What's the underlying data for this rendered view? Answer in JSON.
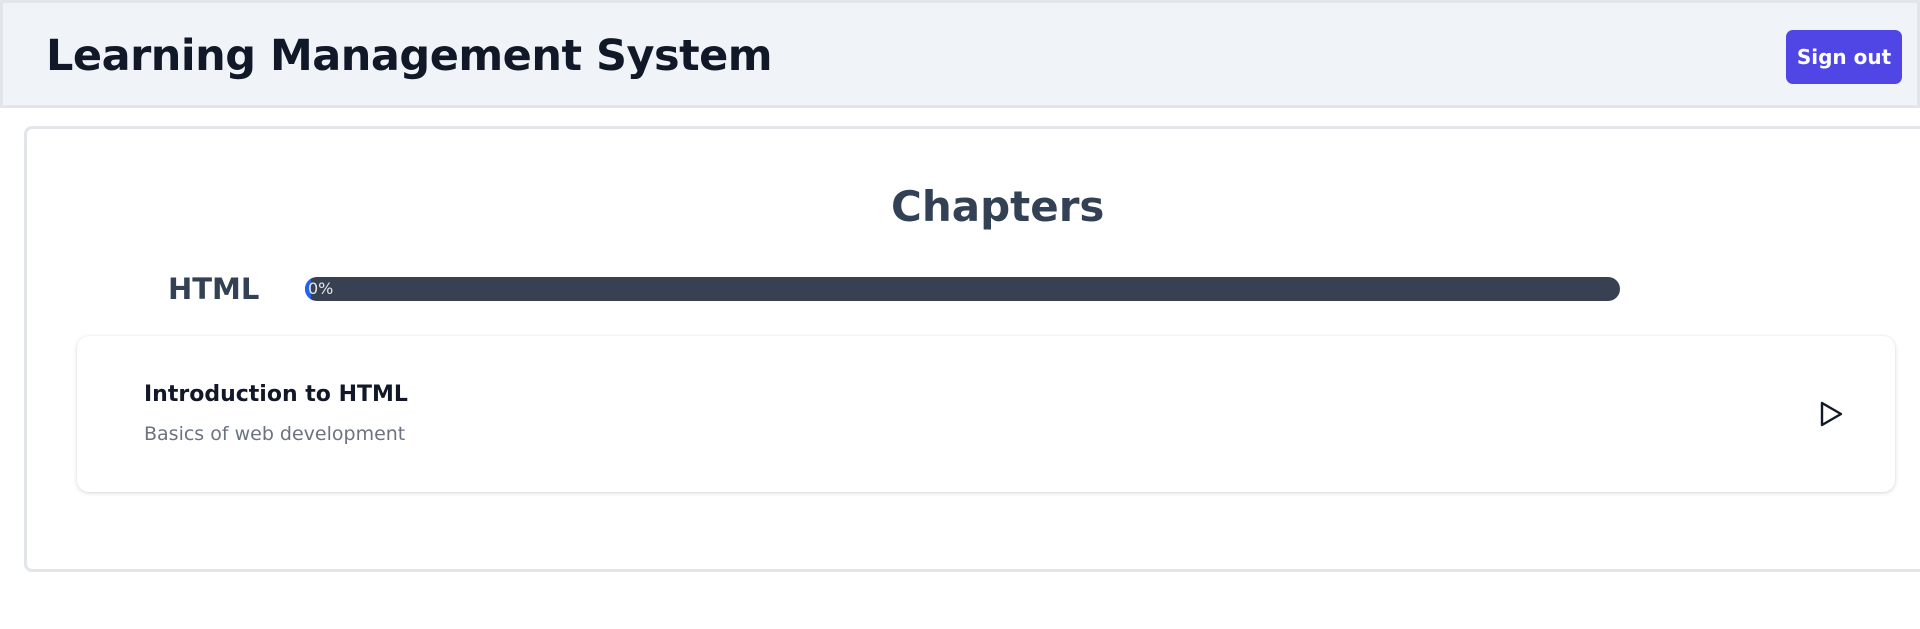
{
  "header": {
    "title": "Learning Management System",
    "signout_label": "Sign out"
  },
  "main": {
    "section_title": "Chapters",
    "course": {
      "name": "HTML",
      "progress_text": "0%",
      "progress_fraction": 0
    },
    "chapters": [
      {
        "title": "Introduction to HTML",
        "description": "Basics of web development",
        "action_icon": "play-icon"
      }
    ]
  },
  "colors": {
    "header_bg": "#f0f3f7",
    "accent": "#4f46e5",
    "progress_track": "#374151",
    "progress_fill": "#2563eb",
    "title_text": "#111827",
    "muted_text": "#6b7280"
  }
}
